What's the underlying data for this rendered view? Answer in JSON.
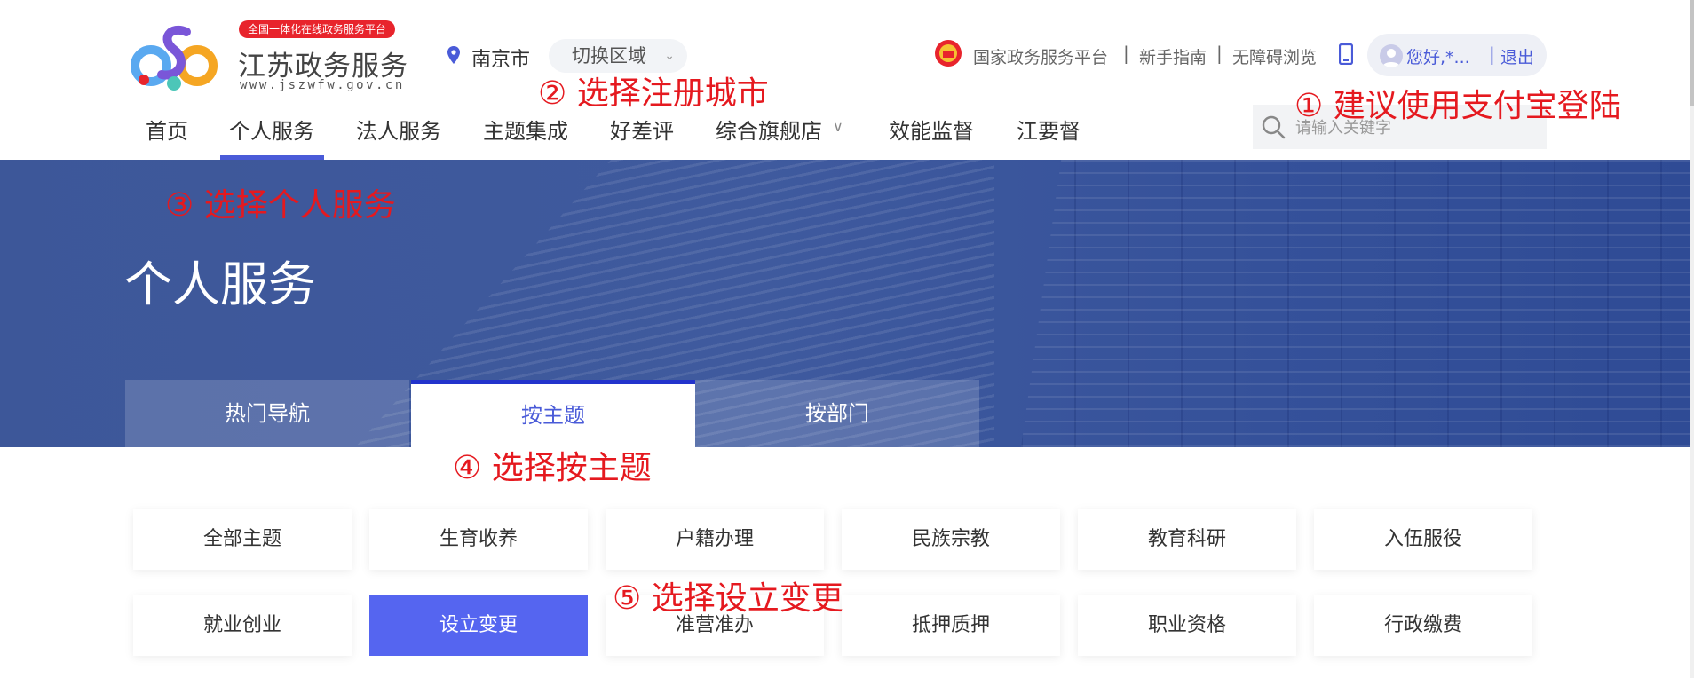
{
  "header": {
    "logo": {
      "tag": "全国一体化在线政务服务平台",
      "title": "江苏政务服务",
      "url": "www.jszwfw.gov.cn"
    },
    "location": {
      "city": "南京市",
      "switch_label": "切换区域"
    },
    "top_links": [
      "国家政务服务平台",
      "新手指南",
      "无障碍浏览"
    ],
    "separator": "|",
    "user": {
      "greeting": "您好,*...",
      "logout": "退出"
    }
  },
  "nav": {
    "items": [
      "首页",
      "个人服务",
      "法人服务",
      "主题集成",
      "好差评",
      "综合旗舰店",
      "效能监督",
      "江要督"
    ],
    "active": "个人服务"
  },
  "search": {
    "placeholder": "请输入关键字"
  },
  "banner": {
    "title": "个人服务",
    "tabs": [
      "热门导航",
      "按主题",
      "按部门"
    ],
    "active_tab": "按主题"
  },
  "themes": [
    [
      "全部主题",
      "生育收养",
      "户籍办理",
      "民族宗教",
      "教育科研",
      "入伍服役"
    ],
    [
      "就业创业",
      "设立变更",
      "准营准办",
      "抵押质押",
      "职业资格",
      "行政缴费"
    ]
  ],
  "selected_theme": "设立变更",
  "annotations": {
    "step1": "① 建议使用支付宝登陆",
    "step2": "② 选择注册城市",
    "step3": "③ 选择个人服务",
    "step4": "④ 选择按主题",
    "step5": "⑤ 选择设立变更"
  },
  "colors": {
    "accent": "#4a5bd8",
    "selected": "#5565f0",
    "banner": "#3d5799",
    "annotation": "#e5191f",
    "logo_tag": "#e8242c"
  }
}
